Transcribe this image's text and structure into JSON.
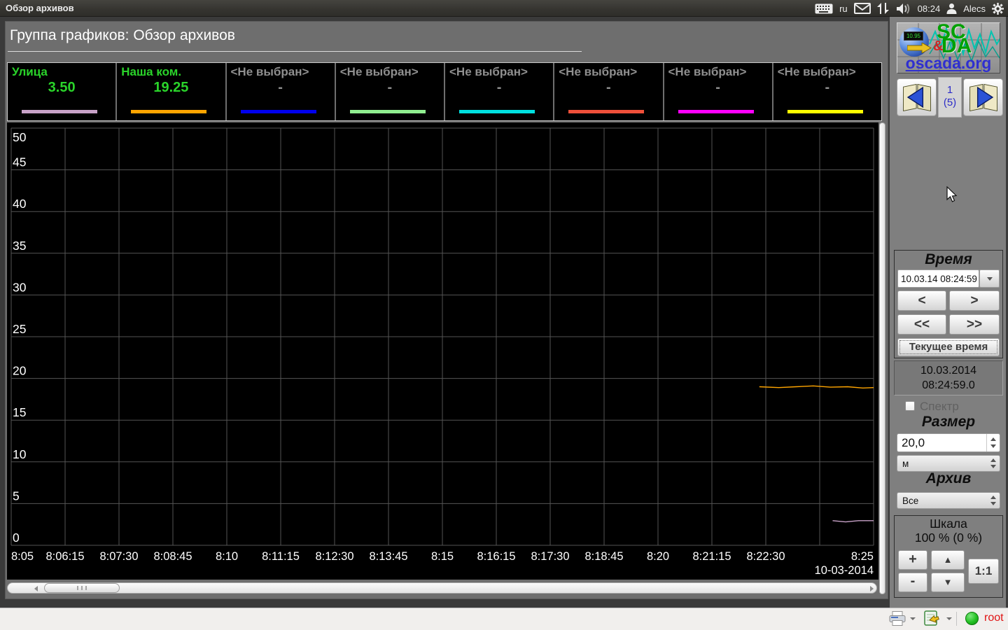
{
  "topbar": {
    "title": "Обзор архивов",
    "lang": "ru",
    "clock": "08:24",
    "user": "Alecs"
  },
  "header": {
    "title": "Группа графиков: Обзор архивов"
  },
  "legend": {
    "items": [
      {
        "label": "Улица",
        "value": "3.50",
        "color": "#c8a2c8",
        "selected": true
      },
      {
        "label": "Наша ком.",
        "value": "19.25",
        "color": "#ffa500",
        "selected": true
      },
      {
        "label": "<Не выбран>",
        "value": "-",
        "color": "#0000ee",
        "selected": false
      },
      {
        "label": "<Не выбран>",
        "value": "-",
        "color": "#90ee90",
        "selected": false
      },
      {
        "label": "<Не выбран>",
        "value": "-",
        "color": "#00e0e0",
        "selected": false
      },
      {
        "label": "<Не выбран>",
        "value": "-",
        "color": "#f0503a",
        "selected": false
      },
      {
        "label": "<Не выбран>",
        "value": "-",
        "color": "#ff00ff",
        "selected": false
      },
      {
        "label": "<Не выбран>",
        "value": "-",
        "color": "#ffff00",
        "selected": false
      }
    ]
  },
  "chart_data": {
    "type": "line",
    "title": "",
    "date_label": "10-03-2014",
    "x_start": "8:05",
    "x_end": "8:25",
    "x_span_minutes": 20,
    "x_tick_labels": [
      "8:05",
      "8:06:15",
      "8:07:30",
      "8:08:45",
      "8:10",
      "8:11:15",
      "8:12:30",
      "8:13:45",
      "8:15",
      "8:16:15",
      "8:17:30",
      "8:18:45",
      "8:20",
      "8:21:15",
      "8:22:30",
      "",
      "8:25"
    ],
    "y_ticks": [
      0,
      5,
      10,
      15,
      20,
      25,
      30,
      35,
      40,
      45,
      50
    ],
    "ylim": [
      0,
      50
    ],
    "grid": true,
    "background": "#000000",
    "grid_color": "#545454",
    "axis_text_color": "#ffffff",
    "series": [
      {
        "name": "Наша ком.",
        "color": "#ffa500",
        "points": [
          [
            17.35,
            19.0
          ],
          [
            17.8,
            18.9
          ],
          [
            18.2,
            19.0
          ],
          [
            18.6,
            19.1
          ],
          [
            19.0,
            18.95
          ],
          [
            19.4,
            19.0
          ],
          [
            19.75,
            18.85
          ],
          [
            20,
            18.9
          ]
        ]
      },
      {
        "name": "Улица",
        "color": "#c8a2c8",
        "points": [
          [
            19.05,
            2.95
          ],
          [
            19.35,
            2.8
          ],
          [
            19.65,
            2.95
          ],
          [
            20,
            2.95
          ]
        ]
      }
    ]
  },
  "sidebar": {
    "logo": {
      "sc": "SC",
      "amp": "&",
      "da": "DA",
      "site": "oscada.org",
      "lcd": "10.95"
    },
    "pager": {
      "page": "1",
      "total": "(5)"
    },
    "time_group": {
      "title": "Время",
      "combo_value": "10.03.14 08:24:59",
      "prev": "<",
      "next": ">",
      "fast_prev": "<<",
      "fast_next": ">>",
      "current": "Текущее время",
      "display_date": "10.03.2014",
      "display_time": "08:24:59.0"
    },
    "spectrum": {
      "label": "Спектр",
      "checked": false
    },
    "size_group": {
      "title": "Размер",
      "value": "20,0",
      "unit": "м"
    },
    "archive_group": {
      "title": "Архив",
      "value": "Все"
    },
    "scale_group": {
      "title": "Шкала",
      "value": "100 % (0 %)",
      "plus": "+",
      "minus": "-",
      "ratio": "1:1"
    }
  },
  "statusbar": {
    "user": "root"
  }
}
